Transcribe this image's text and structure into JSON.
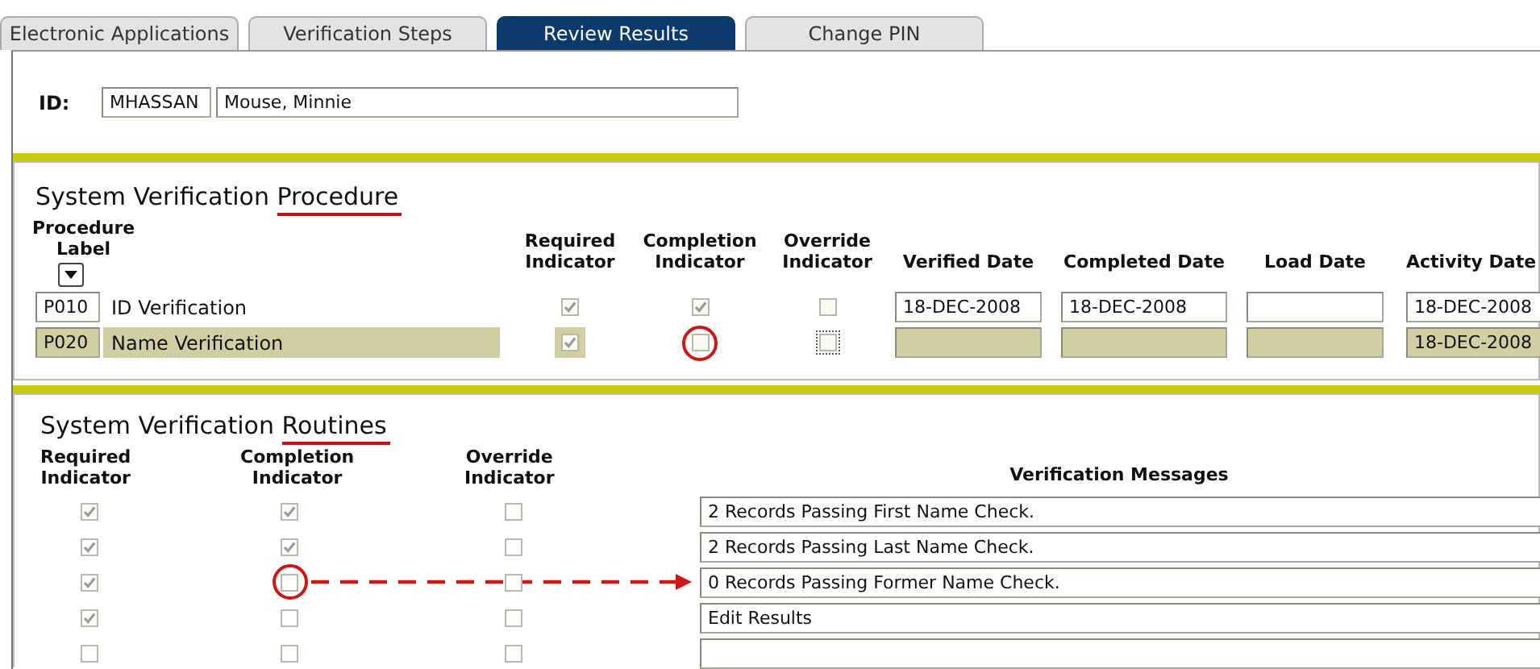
{
  "tabs": [
    {
      "label": "Electronic Applications",
      "selected": false
    },
    {
      "label": "Verification Steps",
      "selected": false
    },
    {
      "label": "Review Results",
      "selected": true
    },
    {
      "label": "Change PIN",
      "selected": false
    }
  ],
  "id_bar": {
    "label": "ID:",
    "id": "MHASSAN",
    "name": "Mouse, Minnie"
  },
  "procedure": {
    "title": "System Verification Procedure",
    "underline_last_word": true,
    "columns": [
      "Procedure Label",
      "Required Indicator",
      "Completion Indicator",
      "Override Indicator",
      "Verified Date",
      "Completed Date",
      "Load Date",
      "Activity Date"
    ],
    "rows": [
      {
        "code": "P010",
        "label": "ID Verification",
        "required": true,
        "completion": true,
        "override": false,
        "verified_date": "18-DEC-2008",
        "completed_date": "18-DEC-2008",
        "activity_date": "18-DEC-2008",
        "selected": false,
        "circled": false
      },
      {
        "code": "P020",
        "label": "Name Verification",
        "required": true,
        "completion": false,
        "override": false,
        "activity_date": "18-DEC-2008",
        "selected": true,
        "circled": true
      }
    ]
  },
  "routines": {
    "title": "System Verification Routines",
    "underline_last_word": true,
    "columns": [
      "Required Indicator",
      "Completion Indicator",
      "Override Indicator",
      "Verification Messages"
    ],
    "rows": [
      {
        "required": true,
        "completion": true,
        "override": false,
        "message": "2 Records Passing First Name Check.",
        "circled": false,
        "arrow": false
      },
      {
        "required": true,
        "completion": true,
        "override": false,
        "message": "2 Records Passing Last Name Check.",
        "circled": false,
        "arrow": false
      },
      {
        "required": true,
        "completion": false,
        "override": false,
        "message": "0 Records Passing Former Name Check.",
        "circled": true,
        "arrow": true
      },
      {
        "required": true,
        "completion": false,
        "override": false,
        "message": "Edit Results",
        "circled": false,
        "arrow": false
      },
      {
        "required": false,
        "completion": false,
        "override": false,
        "circled": false,
        "arrow": false
      }
    ]
  }
}
